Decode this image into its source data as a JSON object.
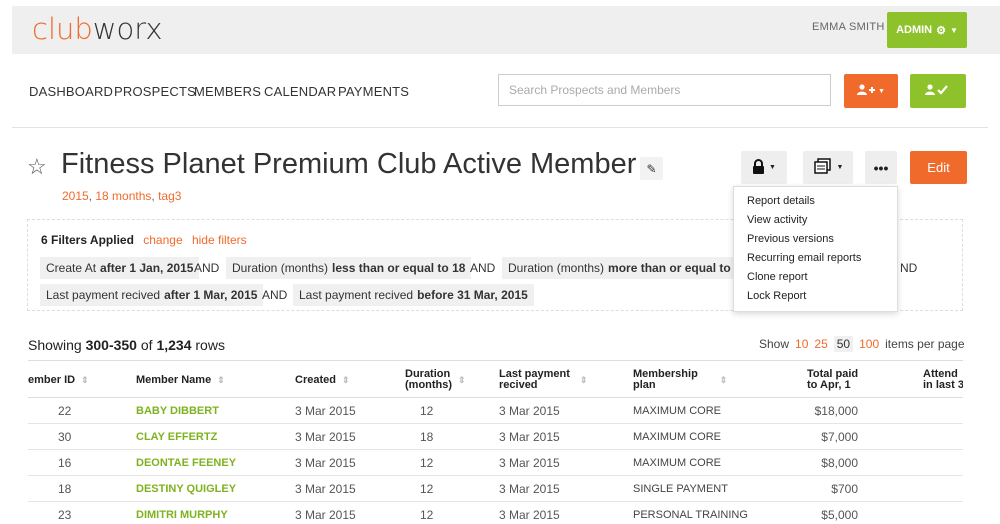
{
  "brand": {
    "logo_part1": "club",
    "logo_part2": "worx"
  },
  "header": {
    "user_name": "EMMA SMITH",
    "admin_label": "ADMIN"
  },
  "nav": {
    "items": [
      "DASHBOARD",
      "PROSPECTS",
      "MEMBERS",
      "CALENDAR",
      "PAYMENTS"
    ],
    "search_placeholder": "Search Prospects and Members"
  },
  "report": {
    "title": "Fitness Planet Premium Club Active Member…",
    "tags": [
      "2015",
      "18 months",
      "tag3"
    ],
    "edit_label": "Edit"
  },
  "menu": {
    "items": [
      "Report details",
      "View activity",
      "Previous versions",
      "Recurring email reports",
      "Clone report",
      "Lock Report"
    ]
  },
  "filters": {
    "applied": "6 Filters Applied",
    "change": "change",
    "hide": "hide filters",
    "and": "AND",
    "chips": [
      {
        "field": "Create At",
        "value": "after 1 Jan, 2015"
      },
      {
        "field": "Duration (months)",
        "value": "less than or equal to 18"
      },
      {
        "field": "Duration (months)",
        "value": "more than or equal to 6"
      },
      {
        "field": "Last payment recived",
        "value": "after 1 Mar, 2015"
      },
      {
        "field": "Last payment recived",
        "value": "before 31 Mar, 2015"
      }
    ],
    "trailing_and": "ND"
  },
  "results": {
    "showing_prefix": "Showing",
    "range": "300-350",
    "of": "of",
    "total": "1,234",
    "suffix": "rows",
    "show_label": "Show",
    "page_sizes": [
      "10",
      "25",
      "50",
      "100"
    ],
    "active_page_size": "50",
    "items_per_page": "items per page"
  },
  "table": {
    "columns": [
      {
        "line1": "ember ID",
        "line2": ""
      },
      {
        "line1": "Member Name",
        "line2": ""
      },
      {
        "line1": "Created",
        "line2": ""
      },
      {
        "line1": "Duration",
        "line2": "(months)"
      },
      {
        "line1": "Last payment",
        "line2": "recived"
      },
      {
        "line1": "Membership",
        "line2": "plan"
      },
      {
        "line1": "Total paid",
        "line2": "to Apr, 1"
      },
      {
        "line1": "Attend",
        "line2": "in last 3"
      }
    ],
    "rows": [
      {
        "id": "22",
        "name": "BABY DIBBERT",
        "created": "3 Mar 2015",
        "duration": "12",
        "last_payment": "3 Mar 2015",
        "plan": "MAXIMUM CORE",
        "total": "$18,000"
      },
      {
        "id": "30",
        "name": "CLAY EFFERTZ",
        "created": "3 Mar 2015",
        "duration": "18",
        "last_payment": "3 Mar 2015",
        "plan": "MAXIMUM CORE",
        "total": "$7,000"
      },
      {
        "id": "16",
        "name": "DEONTAE FEENEY",
        "created": "3 Mar 2015",
        "duration": "12",
        "last_payment": "3 Mar 2015",
        "plan": "MAXIMUM CORE",
        "total": "$8,000"
      },
      {
        "id": "18",
        "name": "DESTINY QUIGLEY",
        "created": "3 Mar 2015",
        "duration": "12",
        "last_payment": "3 Mar 2015",
        "plan": "SINGLE PAYMENT",
        "total": "$700"
      },
      {
        "id": "23",
        "name": "DIMITRI MURPHY",
        "created": "3 Mar 2015",
        "duration": "12",
        "last_payment": "3 Mar 2015",
        "plan": "PERSONAL TRAINING",
        "total": "$5,000"
      }
    ]
  },
  "colors": {
    "accent_orange": "#f06a2b",
    "accent_green": "#8dc22b"
  },
  "icons": [
    "star-icon",
    "pencil-icon",
    "lock-icon",
    "report-icon",
    "more-icon",
    "gear-icon",
    "add-user-icon",
    "user-check-icon",
    "sort-icon"
  ]
}
